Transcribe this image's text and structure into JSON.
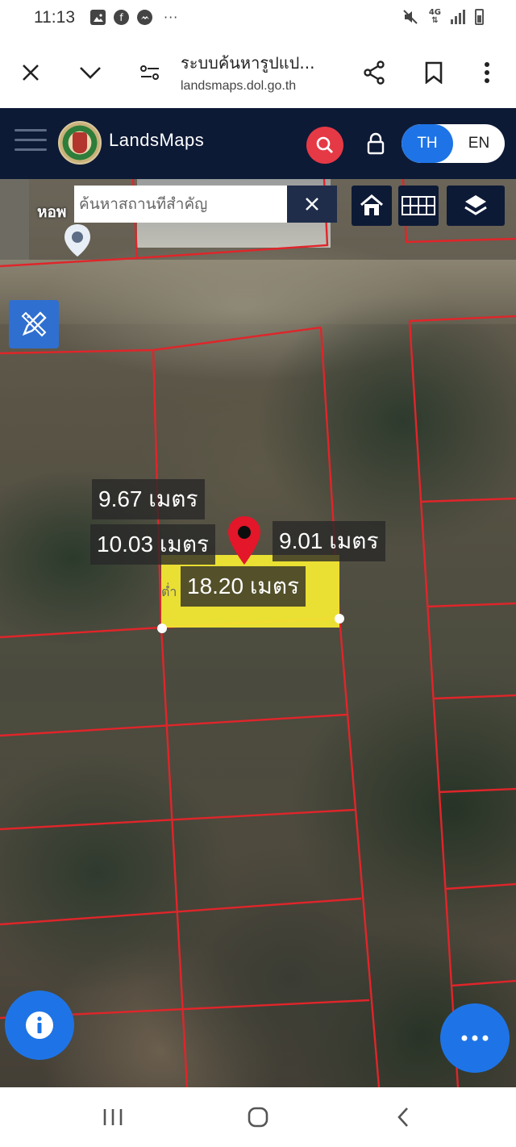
{
  "status_bar": {
    "time": "11:13",
    "left_icons": [
      "gallery-icon",
      "facebook-icon",
      "messenger-icon"
    ],
    "overflow": "···",
    "network_type": "4G",
    "right_icons": [
      "mute-icon",
      "signal-icon",
      "battery-icon"
    ]
  },
  "browser": {
    "page_title": "ระบบค้นหารูปแป...",
    "host": "landsmaps.dol.go.th",
    "buttons": [
      "close-icon",
      "chevron-down-icon",
      "site-settings-icon",
      "share-icon",
      "bookmark-icon",
      "more-vertical-icon"
    ]
  },
  "app": {
    "brand": "LandsMaps",
    "languages": [
      {
        "label": "TH",
        "active": true
      },
      {
        "label": "EN",
        "active": false
      }
    ],
    "accent_color": "#1e74e6",
    "header_color": "#0d1a36",
    "search_button_color": "#e63946"
  },
  "map": {
    "search_placeholder": "ค้นหาสถานที่สำคัญ",
    "poi_label": "หอพ",
    "parcel_highlight_color": "#f2e733",
    "parcel_line_color": "#e0252a",
    "measurements": {
      "top": "9.67 เมตร",
      "left": "10.03 เมตร",
      "right": "9.01 เมตร",
      "bottom": "18.20 เมตร"
    },
    "parcel_number_text": "ต่ำ",
    "tools": [
      "home-icon",
      "grid-icon",
      "layers-icon",
      "draw-tool-icon"
    ],
    "fab": [
      "info-icon",
      "more-horizontal-icon"
    ]
  },
  "nav_bar": {
    "buttons": [
      "recent-apps-icon",
      "home-nav-icon",
      "back-icon"
    ]
  }
}
